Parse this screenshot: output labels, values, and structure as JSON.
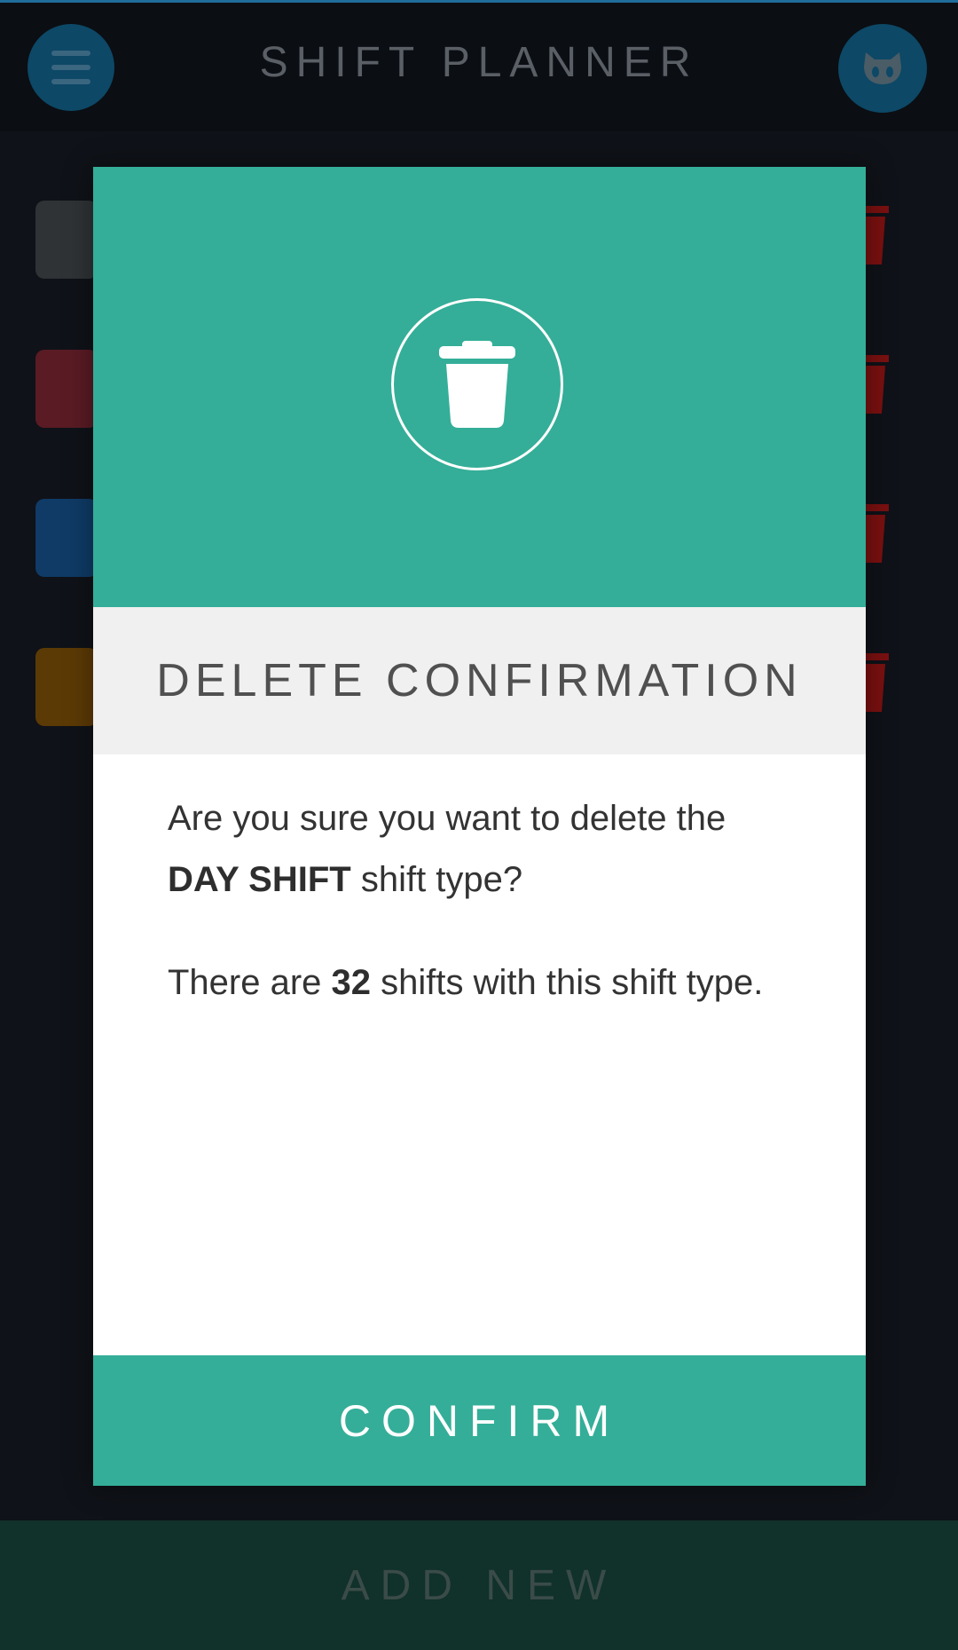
{
  "header": {
    "title": "SHIFT PLANNER",
    "menu_icon": "hamburger-menu-icon",
    "github_icon": "github-octocat-icon"
  },
  "background_list": {
    "items": [
      {
        "swatch_color": "#2f3336"
      },
      {
        "swatch_color": "#5a1b24"
      },
      {
        "swatch_color": "#0f3b66"
      },
      {
        "swatch_color": "#5c3a05"
      }
    ],
    "trash_color": "#7a1010"
  },
  "dialog": {
    "icon": "trash-icon",
    "title": "DELETE CONFIRMATION",
    "line1_prefix": "Are you sure you want to delete the ",
    "shift_type_name": "DAY SHIFT",
    "line1_suffix": " shift type?",
    "line2_prefix": "There are ",
    "shift_count": "32",
    "line2_suffix": " shifts with this shift type.",
    "confirm_label": "CONFIRM",
    "accent_color": "#34ae98"
  },
  "footer": {
    "add_new_label": "ADD NEW"
  }
}
